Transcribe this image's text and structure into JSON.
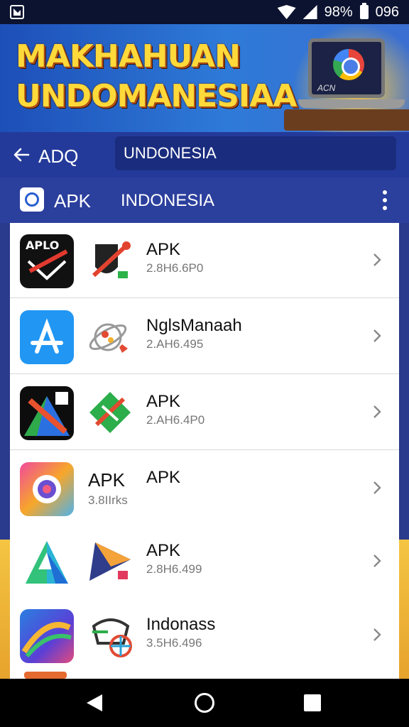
{
  "status_bar": {
    "battery": "98%",
    "time": "096"
  },
  "banner": {
    "line1": "MAKHAHUAN",
    "line2": "UNDOMANESIAA",
    "laptop_label": "ACN"
  },
  "search": {
    "back_label": "ADQ",
    "query": "UNDONESIA"
  },
  "header": {
    "title": "APK",
    "subtitle": "INDONESIA"
  },
  "apps": [
    {
      "name": "APK",
      "sub": "2.8H6.6P0",
      "icon1_text": "APLO"
    },
    {
      "name": "NglsManaah",
      "sub": "2.AH6.495"
    },
    {
      "name": "APK",
      "sub": "2.AH6.4P0"
    },
    {
      "name": "APK",
      "sub": "3.8IIrks",
      "icon2_text": "APK"
    },
    {
      "name": "APK",
      "sub": "2.8H6.499"
    },
    {
      "name": "Indonass",
      "sub": "3.5H6.496"
    }
  ],
  "colors": {
    "banner_title": "#ffd93a",
    "header_bg": "#2b3f9d",
    "list_bg": "#ffffff"
  }
}
